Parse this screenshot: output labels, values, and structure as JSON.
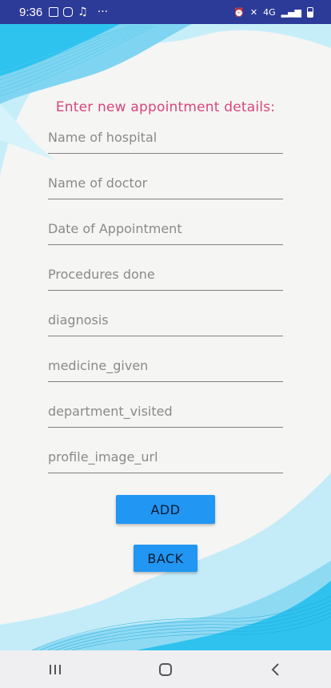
{
  "status_bar": {
    "time": "9:36",
    "left_icons": [
      "image-icon",
      "instagram-icon",
      "music-note-icon",
      "more-icon"
    ],
    "more_text": "···",
    "right_icons": [
      "alarm-icon",
      "mute-icon",
      "signal-4g-icon",
      "signal-bars-icon",
      "battery-icon"
    ],
    "network_text": "4G"
  },
  "form": {
    "heading": "Enter new appointment details:",
    "fields": [
      {
        "placeholder": "Name of hospital",
        "value": ""
      },
      {
        "placeholder": "Name of doctor",
        "value": ""
      },
      {
        "placeholder": "Date of Appointment",
        "value": ""
      },
      {
        "placeholder": "Procedures done",
        "value": ""
      },
      {
        "placeholder": "diagnosis",
        "value": ""
      },
      {
        "placeholder": "medicine_given",
        "value": ""
      },
      {
        "placeholder": "department_visited",
        "value": ""
      },
      {
        "placeholder": "profile_image_url",
        "value": ""
      }
    ],
    "add_label": "ADD",
    "back_label": "BACK"
  },
  "nav_bar": {
    "icons": [
      "recent-apps-icon",
      "home-icon",
      "back-icon"
    ]
  },
  "colors": {
    "status_bar": "#2c3a98",
    "heading": "#d8447a",
    "button": "#2196f3",
    "wave_light": "#b5e8f7",
    "wave_bright": "#2fc2ee"
  }
}
